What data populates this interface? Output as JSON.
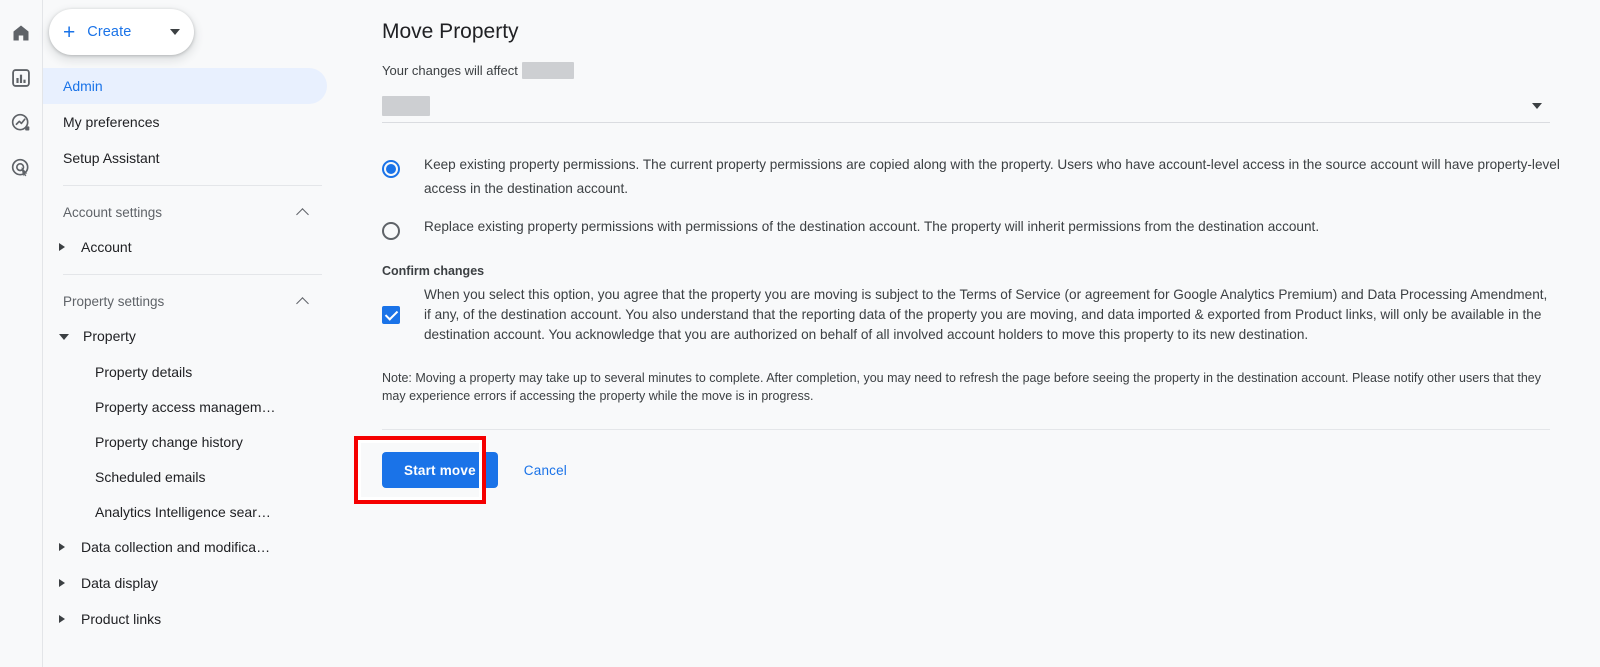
{
  "rail": {
    "icons": [
      {
        "name": "home-icon",
        "label": "Home"
      },
      {
        "name": "reports-bar-chart-icon",
        "label": "Reports"
      },
      {
        "name": "explore-icon",
        "label": "Explore"
      },
      {
        "name": "advertising-target-icon",
        "label": "Advertising"
      }
    ]
  },
  "sidebar": {
    "create_button": {
      "label": "Create",
      "plus": "+"
    },
    "top_items": [
      {
        "label": "Admin",
        "active": true
      },
      {
        "label": "My preferences",
        "active": false
      },
      {
        "label": "Setup Assistant",
        "active": false
      }
    ],
    "account_section": {
      "label": "Account settings",
      "expanded": true
    },
    "account_item": {
      "label": "Account",
      "expanded": false
    },
    "property_section": {
      "label": "Property settings",
      "expanded": true
    },
    "property_item": {
      "label": "Property",
      "expanded": true
    },
    "property_subitems": [
      {
        "label": "Property details"
      },
      {
        "label": "Property access managem…"
      },
      {
        "label": "Property change history"
      },
      {
        "label": "Scheduled emails"
      },
      {
        "label": "Analytics Intelligence sear…"
      }
    ],
    "collapsed_groups": [
      {
        "label": "Data collection and modifica…"
      },
      {
        "label": "Data display"
      },
      {
        "label": "Product links"
      }
    ]
  },
  "main": {
    "title": "Move Property",
    "affect_label": "Your changes will affect",
    "affect_value_redacted": true,
    "destination_select": {
      "value_redacted": true,
      "caret": "chevron-down"
    },
    "permission_options": [
      {
        "id": "keep",
        "selected": true,
        "label": "Keep existing property permissions. The current property permissions are copied along with the property. Users who have account-level access in the source account will have property-level access in the destination account."
      },
      {
        "id": "replace",
        "selected": false,
        "label": "Replace existing property permissions with permissions of the destination account. The property will inherit permissions from the destination account."
      }
    ],
    "confirm": {
      "heading": "Confirm changes",
      "checked": true,
      "text": "When you select this option, you agree that the property you are moving is subject to the Terms of Service (or agreement for Google Analytics Premium) and Data Processing Amendment, if any, of the destination account. You also understand that the reporting data of the property you are moving, and data imported & exported from Product links, will only be available in the destination account. You acknowledge that you are authorized on behalf of all involved account holders to move this property to its new destination."
    },
    "note": "Note: Moving a property may take up to several minutes to complete. After completion, you may need to refresh the page before seeing the property in the destination account. Please notify other users that they may experience errors if accessing the property while the move is in progress.",
    "actions": {
      "primary_label": "Start move",
      "secondary_label": "Cancel",
      "highlighted_target": "Start move"
    }
  },
  "colors": {
    "accent": "#1a73e8",
    "active_nav_bg": "#e8f0fe",
    "page_bg": "#f8f9fa",
    "highlight_annotation": "#f50000",
    "redaction": "#cdcfd2",
    "text_primary": "#202124",
    "text_secondary": "#3c4043",
    "text_muted": "#5f6368"
  }
}
